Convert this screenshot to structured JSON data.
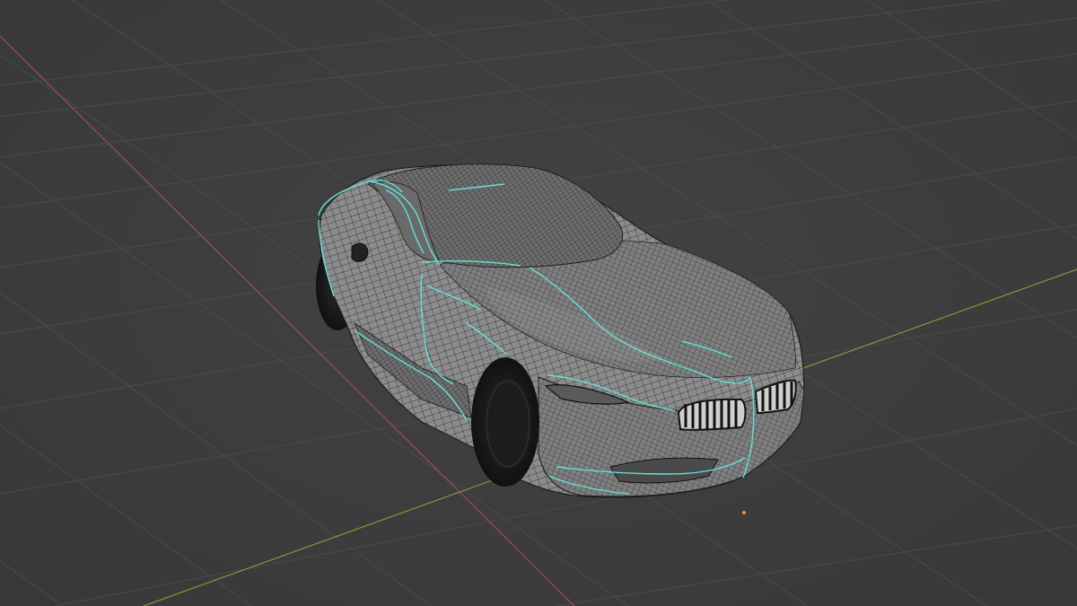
{
  "viewport": {
    "mode": "3d-view",
    "shading": "wireframe-overlay",
    "background_color": "#3d3d3d",
    "grid_color": "#4b4b4b",
    "x_axis_color": "#9c4a4f",
    "y_axis_color": "#7a9436"
  },
  "scene": {
    "object": "car-body-mesh",
    "body_color": "#8e8e8e",
    "wire_color": "#1c1c1c",
    "selected_edge_color": "#5fe3d8",
    "tire_color": "#161616",
    "origin_color": "#ff8a1a"
  }
}
